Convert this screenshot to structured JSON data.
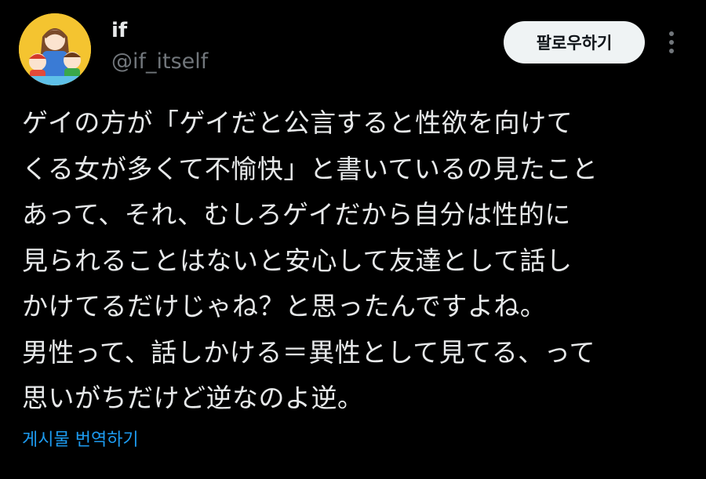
{
  "author": {
    "display_name": "if",
    "handle": "@if_itself",
    "avatar_icon": "avatar-illustration-icon"
  },
  "actions": {
    "follow_label": "팔로우하기",
    "more_icon": "more-vertical-icon"
  },
  "tweet": {
    "lines": [
      "ゲイの方が「ゲイだと公言すると性欲を向けて",
      "くる女が多くて不愉快」と書いているの見たこと",
      "あって、それ、むしろゲイだから自分は性的に",
      "見られることはないと安心して友達として話し",
      "かけてるだけじゃね？と思ったんですよね。",
      "男性って、話しかける＝異性として見てる、って",
      "思いがちだけど逆なのよ逆。"
    ]
  },
  "translate": {
    "label": "게시물 번역하기"
  },
  "colors": {
    "background": "#000000",
    "text_primary": "#e7e9ea",
    "text_secondary": "#71767b",
    "link": "#1d9bf0",
    "follow_bg": "#eff3f4",
    "follow_text": "#0f1419",
    "avatar_bg": "#f4c430"
  }
}
